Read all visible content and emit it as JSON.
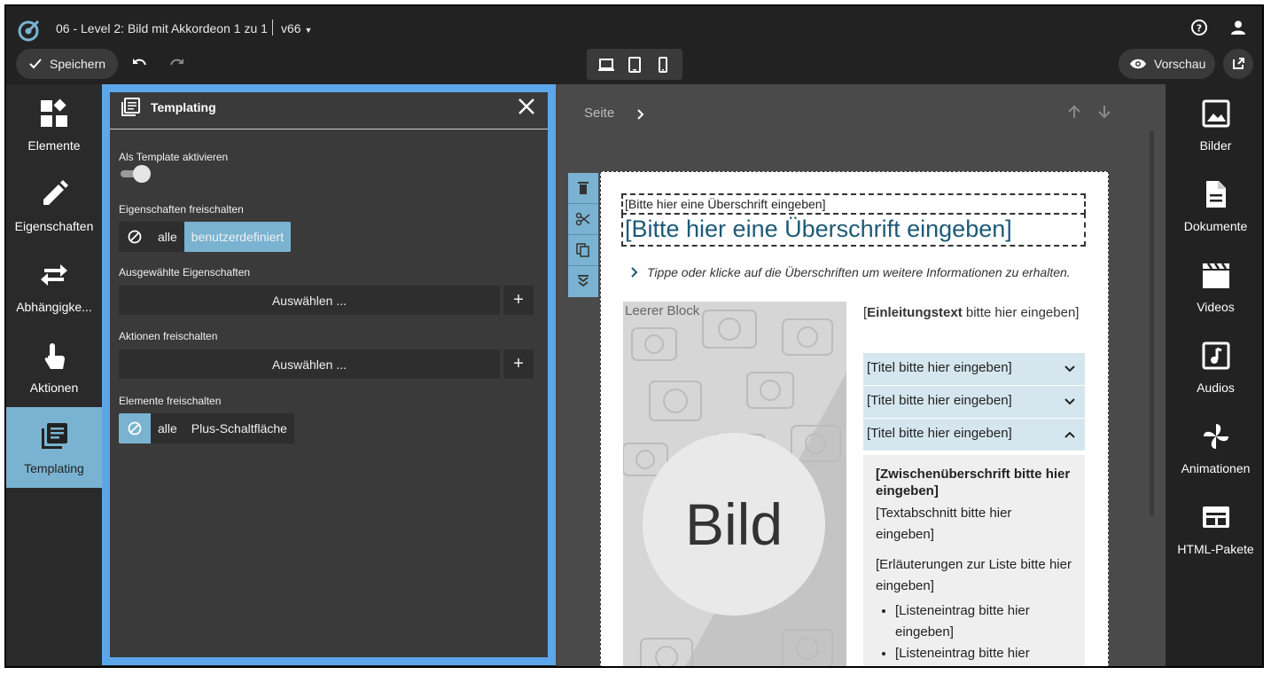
{
  "app": {
    "doc_title": "06 - Level 2: Bild mit Akkordeon 1 zu 1",
    "version": "v66"
  },
  "toolbar": {
    "save_label": "Speichern",
    "preview_label": "Vorschau"
  },
  "left_sidebar": {
    "items": [
      {
        "label": "Elemente",
        "icon": "widgets-icon"
      },
      {
        "label": "Eigenschaften",
        "icon": "pencil-icon"
      },
      {
        "label": "Abhängigke...",
        "icon": "swap-arrows-icon"
      },
      {
        "label": "Aktionen",
        "icon": "touch-hand-icon"
      },
      {
        "label": "Templating",
        "icon": "library-books-icon",
        "active": true
      }
    ]
  },
  "templating": {
    "title": "Templating",
    "activate_label": "Als Template aktivieren",
    "activate_value": false,
    "props_label": "Eigenschaften freischalten",
    "props_options": [
      "alle",
      "benutzerdefiniert"
    ],
    "props_selected": "benutzerdefiniert",
    "selected_props_label": "Ausgewählte Eigenschaften",
    "select_button": "Auswählen ...",
    "actions_label": "Aktionen freischalten",
    "actions_select_button": "Auswählen ...",
    "elements_label": "Elemente freischalten",
    "elements_options": [
      "alle",
      "Plus-Schaltfläche"
    ],
    "elements_selected": "none"
  },
  "canvas": {
    "breadcrumb": "Seite",
    "heading_small": "[Bitte hier eine Überschrift eingeben]",
    "heading_big": "[Bitte hier eine Überschrift eingeben]",
    "hint": "Tippe oder klicke auf die Überschriften um weitere Informationen zu erhalten.",
    "image_block_label": "Leerer Block",
    "image_text": "Bild",
    "intro_bold": "Einleitungstext",
    "intro_open": "[",
    "intro_rest": " bitte hier eingeben]",
    "accordion": [
      {
        "title": "[Titel bitte hier eingeben]",
        "expanded": false
      },
      {
        "title": "[Titel bitte hier eingeben]",
        "expanded": false
      },
      {
        "title": "[Titel bitte hier eingeben]",
        "expanded": true
      }
    ],
    "acc_subheading": "[Zwischenüberschrift bitte hier eingeben]",
    "acc_paragraph": "[Textabschnitt bitte hier eingeben]",
    "acc_list_intro": "[Erläuterungen zur Liste bitte hier eingeben]",
    "acc_list": [
      "[Listeneintrag bitte hier eingeben]",
      "[Listeneintrag bitte hier eingeben]"
    ]
  },
  "right_sidebar": {
    "items": [
      {
        "label": "Bilder",
        "icon": "image-icon"
      },
      {
        "label": "Dokumente",
        "icon": "document-icon"
      },
      {
        "label": "Videos",
        "icon": "clapperboard-icon"
      },
      {
        "label": "Audios",
        "icon": "music-note-icon"
      },
      {
        "label": "Animationen",
        "icon": "pinwheel-icon"
      },
      {
        "label": "HTML-Pakete",
        "icon": "web-package-icon"
      }
    ]
  },
  "colors": {
    "accent": "#7ab3d1",
    "panel_border": "#5ca7ea",
    "heading": "#1d5a78"
  }
}
